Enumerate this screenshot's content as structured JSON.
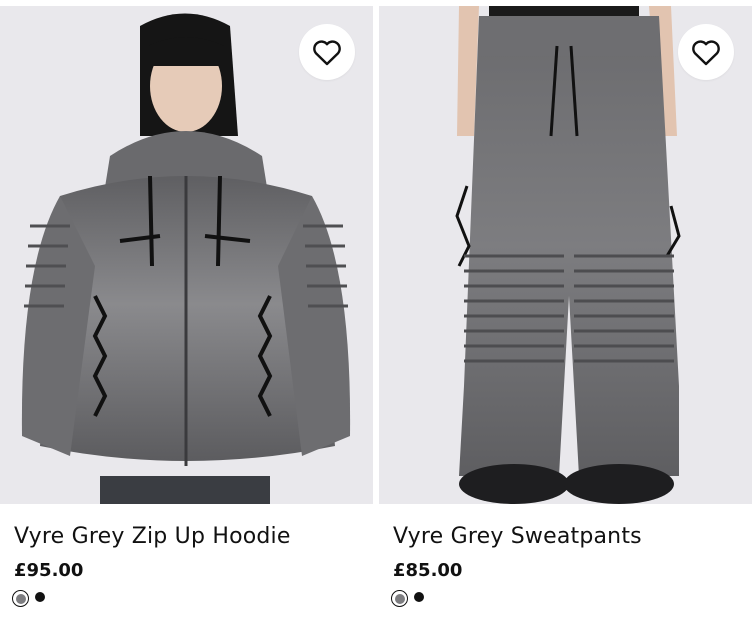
{
  "products": [
    {
      "name": "Vyre Grey Zip Up Hoodie",
      "price": "£95.00",
      "image_icon": "hoodie-product-photo",
      "swatches": [
        {
          "color": "#7d7d80",
          "selected": true
        },
        {
          "color": "#111111",
          "selected": false
        }
      ]
    },
    {
      "name": "Vyre Grey Sweatpants",
      "price": "£85.00",
      "image_icon": "sweatpants-product-photo",
      "swatches": [
        {
          "color": "#7d7d80",
          "selected": true
        },
        {
          "color": "#111111",
          "selected": false
        }
      ]
    }
  ],
  "icons": {
    "wishlist": "heart-outline-icon"
  },
  "colors": {
    "background": "#e9e8ec",
    "text": "#111111",
    "garment": "#7a7a7d"
  }
}
